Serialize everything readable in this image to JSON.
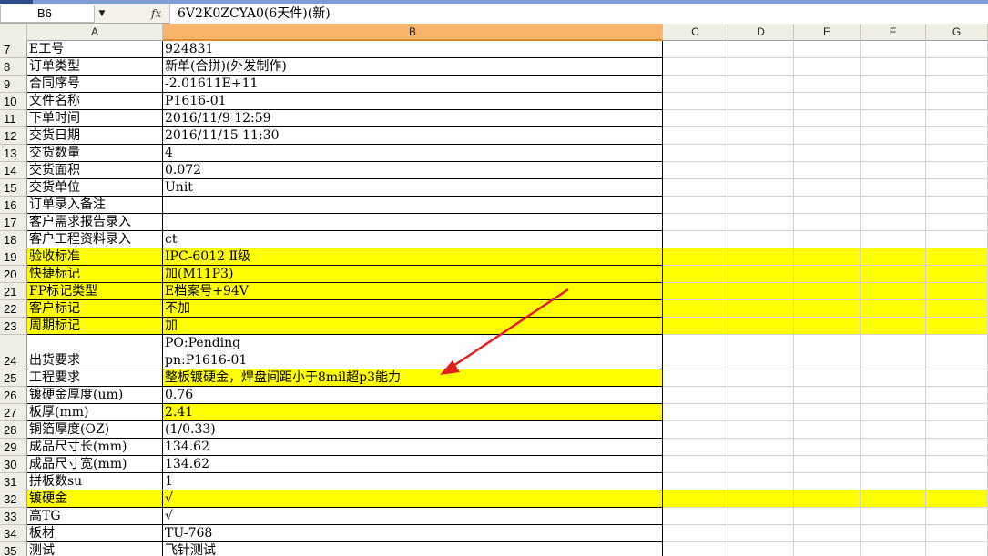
{
  "formula_bar": {
    "name_box": "B6",
    "fx_label": "fx",
    "formula": "6V2K0ZCYA0(6天件)(新)"
  },
  "columns": [
    "A",
    "B",
    "C",
    "D",
    "E",
    "F",
    "G"
  ],
  "rows": [
    {
      "num": "7",
      "a": "E工号",
      "b": "924831",
      "highlight": false
    },
    {
      "num": "8",
      "a": "订单类型",
      "b": "新单(合拼)(外发制作)",
      "highlight": false
    },
    {
      "num": "9",
      "a": "合同序号",
      "b": "-2.01611E+11",
      "highlight": false
    },
    {
      "num": "10",
      "a": "文件名称",
      "b": "P1616-01",
      "highlight": false
    },
    {
      "num": "11",
      "a": "下单时间",
      "b": "2016/11/9 12:59",
      "highlight": false
    },
    {
      "num": "12",
      "a": "交货日期",
      "b": "2016/11/15 11:30",
      "highlight": false
    },
    {
      "num": "13",
      "a": "交货数量",
      "b": "4",
      "highlight": false
    },
    {
      "num": "14",
      "a": "交货面积",
      "b": "0.072",
      "highlight": false
    },
    {
      "num": "15",
      "a": "交货单位",
      "b": "Unit",
      "highlight": false
    },
    {
      "num": "16",
      "a": "订单录入备注",
      "b": "",
      "highlight": false
    },
    {
      "num": "17",
      "a": "客户需求报告录入",
      "b": "",
      "highlight": false
    },
    {
      "num": "18",
      "a": "客户工程资料录入",
      "b": "ct",
      "highlight": false
    },
    {
      "num": "19",
      "a": "验收标准",
      "b": "IPC-6012 Ⅱ级",
      "highlight": true
    },
    {
      "num": "20",
      "a": "快捷标记",
      "b": "加(M11P3)",
      "highlight": true
    },
    {
      "num": "21",
      "a": "FP标记类型",
      "b": "E档案号+94V",
      "highlight": true
    },
    {
      "num": "22",
      "a": "客户标记",
      "b": "不加",
      "highlight": true
    },
    {
      "num": "23",
      "a": "周期标记",
      "b": "加",
      "highlight": true
    },
    {
      "num": "24",
      "a": "出货要求",
      "b": "PO:Pending",
      "b2": "pn:P1616-01",
      "highlight": false,
      "tall": true
    },
    {
      "num": "25",
      "a": "工程要求",
      "b": "整板镀硬金，焊盘间距小于8mil超p3能力",
      "highlight": false,
      "highlight_b": true
    },
    {
      "num": "26",
      "a": "镀硬金厚度(um)",
      "b": "0.76",
      "highlight": false
    },
    {
      "num": "27",
      "a": "板厚(mm)",
      "b": "2.41",
      "highlight": false,
      "highlight_b": true
    },
    {
      "num": "28",
      "a": "铜箔厚度(OZ)",
      "b": "(1/0.33)",
      "highlight": false
    },
    {
      "num": "29",
      "a": "成品尺寸长(mm)",
      "b": "134.62",
      "highlight": false
    },
    {
      "num": "30",
      "a": "成品尺寸宽(mm)",
      "b": "134.62",
      "highlight": false
    },
    {
      "num": "31",
      "a": "拼板数su",
      "b": "1",
      "highlight": false
    },
    {
      "num": "32",
      "a": "镀硬金",
      "b": "√",
      "highlight": true
    },
    {
      "num": "33",
      "a": "高TG",
      "b": "√",
      "highlight": false
    },
    {
      "num": "34",
      "a": "板材",
      "b": "TU-768",
      "highlight": false
    },
    {
      "num": "35",
      "a": "测试",
      "b": "飞针测试",
      "highlight": false
    }
  ],
  "colors": {
    "highlight": "#ffff00",
    "arrow": "#e0201e",
    "selected_header": "#f7b46a"
  }
}
